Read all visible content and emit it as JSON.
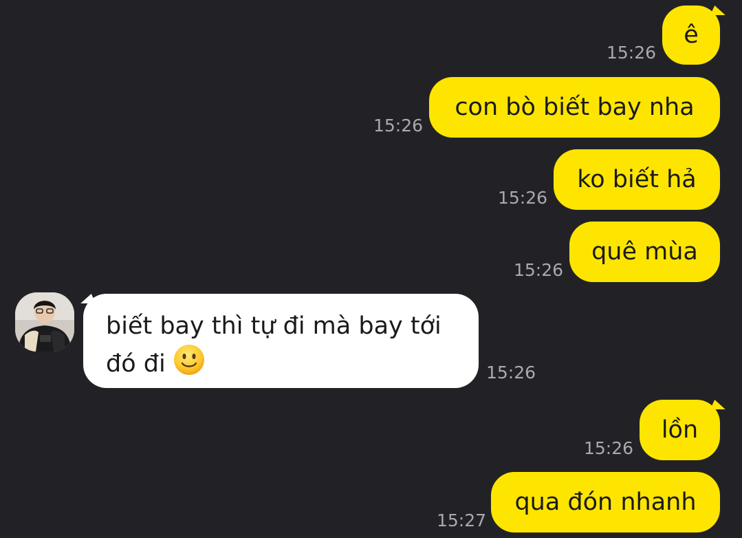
{
  "messages": [
    {
      "direction": "outgoing",
      "text": "ê",
      "time": "15:26"
    },
    {
      "direction": "outgoing",
      "text": "con bò biết bay nha",
      "time": "15:26"
    },
    {
      "direction": "outgoing",
      "text": "ko biết hả",
      "time": "15:26"
    },
    {
      "direction": "outgoing",
      "text": "quê mùa",
      "time": "15:26"
    },
    {
      "direction": "incoming",
      "text": "biết bay thì tự đi mà bay tới đó đi",
      "emoji": "slightly-smiling-face-emoji",
      "time": "15:26"
    },
    {
      "direction": "outgoing",
      "text": "lồn",
      "time": "15:26"
    },
    {
      "direction": "outgoing",
      "text": "qua đón nhanh",
      "time": "15:27"
    }
  ],
  "colors": {
    "background": "#222226",
    "outgoing_bubble": "#fee500",
    "incoming_bubble": "#ffffff",
    "timestamp": "#a9a9ae",
    "text": "#1a1a1a"
  }
}
